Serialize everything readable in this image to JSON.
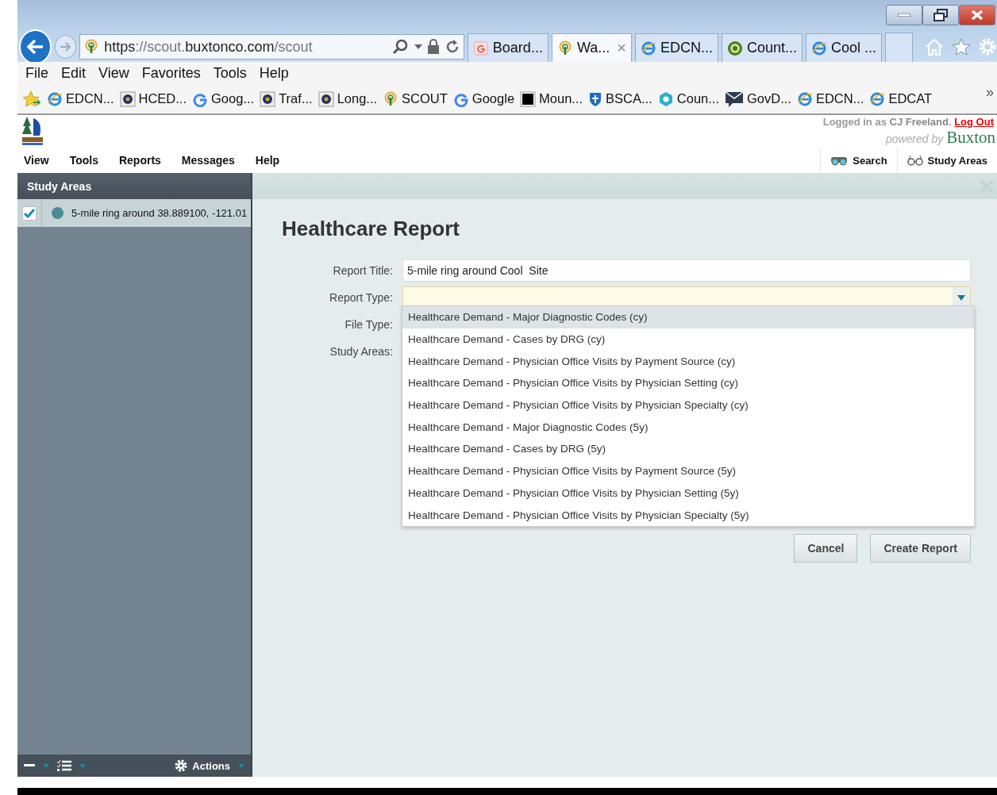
{
  "browser": {
    "address": [
      {
        "text": "https",
        "strong": true
      },
      {
        "text": "://scout.",
        "strong": false
      },
      {
        "text": "buxtonco.com",
        "strong": true
      },
      {
        "text": "/scout",
        "strong": false
      }
    ],
    "tabs": [
      {
        "label": "Board...",
        "kind": "gdoc",
        "selected": false,
        "closable": false
      },
      {
        "label": "Wa...",
        "kind": "scout",
        "selected": true,
        "closable": true
      },
      {
        "label": "EDCN...",
        "kind": "ie",
        "selected": false,
        "closable": false
      },
      {
        "label": "Count...",
        "kind": "green",
        "selected": false,
        "closable": false
      },
      {
        "label": "Cool ...",
        "kind": "ie",
        "selected": false,
        "closable": false
      }
    ],
    "close_tab": "×",
    "menu": [
      "File",
      "Edit",
      "View",
      "Favorites",
      "Tools",
      "Help"
    ],
    "favorites": [
      {
        "label": "EDCN...",
        "kind": "ie"
      },
      {
        "label": "HCED...",
        "kind": "seal"
      },
      {
        "label": "Goog...",
        "kind": "google"
      },
      {
        "label": "Traf...",
        "kind": "seal"
      },
      {
        "label": "Long...",
        "kind": "seal"
      },
      {
        "label": "SCOUT",
        "kind": "scout"
      },
      {
        "label": "Google",
        "kind": "google"
      },
      {
        "label": "Moun...",
        "kind": "black"
      },
      {
        "label": "BSCA...",
        "kind": "shield"
      },
      {
        "label": "Coun...",
        "kind": "hex"
      },
      {
        "label": "GovD...",
        "kind": "mail"
      },
      {
        "label": "EDCN...",
        "kind": "ie"
      },
      {
        "label": "EDCAT",
        "kind": "ie"
      }
    ],
    "more": "»"
  },
  "app": {
    "login": {
      "prefix": "Logged in as",
      "user": "CJ Freeland",
      "suffix": ".",
      "logout": "Log Out"
    },
    "powered": {
      "prefix": "powered by",
      "brand": "Buxton"
    },
    "nav": [
      "View",
      "Tools",
      "Reports",
      "Messages",
      "Help"
    ],
    "nav_right": [
      {
        "label": "Search",
        "kind": "binoculars"
      },
      {
        "label": "Study Areas",
        "kind": "glasses"
      }
    ],
    "sidebar": {
      "title": "Study Areas",
      "items": [
        {
          "label": "5-mile ring around 38.889100, -121.01",
          "checked": true,
          "color": "#4a8a96"
        }
      ],
      "footer": {
        "actions": "Actions"
      }
    },
    "form": {
      "title": "Healthcare Report",
      "fields": [
        {
          "label": "Report Title:",
          "kind": "text",
          "value": "5-mile ring around Cool  Site",
          "focused": false
        },
        {
          "label": "Report Type:",
          "kind": "select",
          "focused": true
        },
        {
          "label": "File Type:",
          "kind": "label"
        },
        {
          "label": "Study Areas:",
          "kind": "label"
        }
      ],
      "options": [
        {
          "label": "Healthcare Demand - Major Diagnostic Codes (cy)",
          "selected": true
        },
        {
          "label": "Healthcare Demand - Cases by DRG (cy)",
          "selected": false
        },
        {
          "label": "Healthcare Demand - Physician Office Visits by Payment Source (cy)",
          "selected": false
        },
        {
          "label": "Healthcare Demand - Physician Office Visits by Physician Setting (cy)",
          "selected": false
        },
        {
          "label": "Healthcare Demand - Physician Office Visits by Physician Specialty (cy)",
          "selected": false
        },
        {
          "label": "Healthcare Demand - Major Diagnostic Codes (5y)",
          "selected": false
        },
        {
          "label": "Healthcare Demand - Cases by DRG (5y)",
          "selected": false
        },
        {
          "label": "Healthcare Demand - Physician Office Visits by Payment Source (5y)",
          "selected": false
        },
        {
          "label": "Healthcare Demand - Physician Office Visits by Physician Setting (5y)",
          "selected": false
        },
        {
          "label": "Healthcare Demand - Physician Office Visits by Physician Specialty (5y)",
          "selected": false
        }
      ],
      "buttons": [
        "Cancel",
        "Create Report"
      ]
    }
  }
}
